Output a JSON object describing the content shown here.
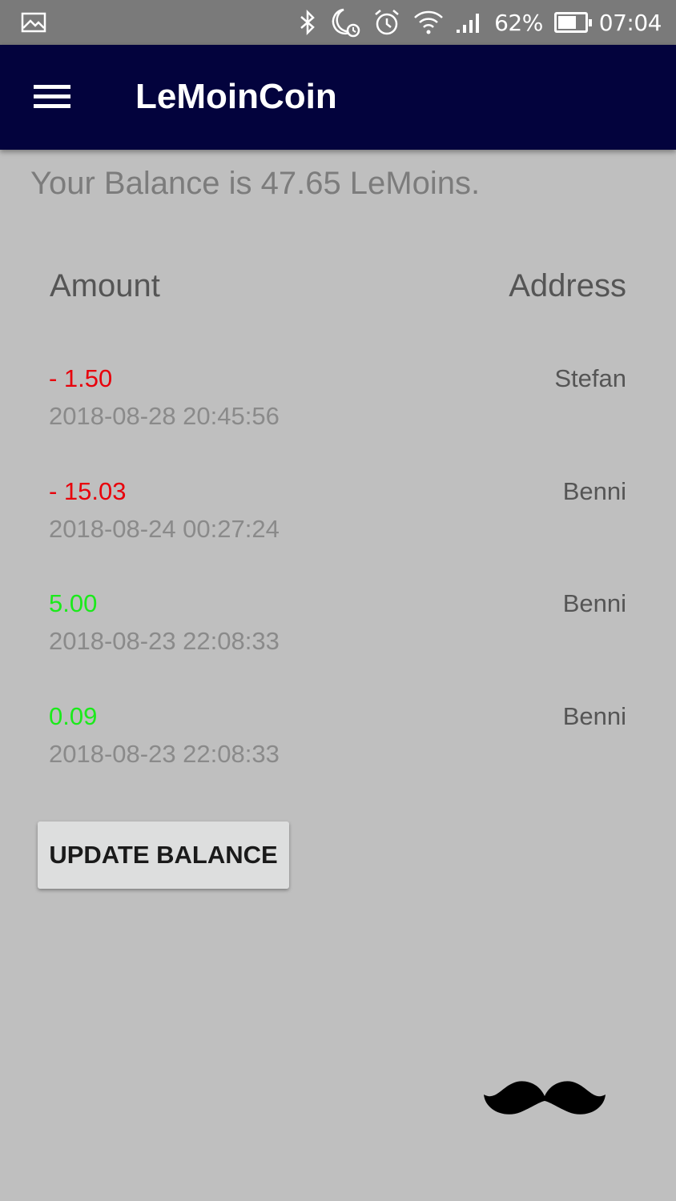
{
  "status_bar": {
    "battery_percent_text": "62%",
    "battery_level": 0.62,
    "time": "07:04",
    "icons": [
      "gallery-icon",
      "bluetooth-icon",
      "do-not-disturb-icon",
      "alarm-icon",
      "wifi-icon",
      "signal-icon",
      "battery-icon"
    ]
  },
  "app_bar": {
    "title": "LeMoinCoin",
    "menu_icon": "hamburger-menu-icon",
    "background_color": "#03033d"
  },
  "balance_text": "Your Balance is 47.65 LeMoins.",
  "table": {
    "headers": {
      "amount": "Amount",
      "address": "Address"
    },
    "transactions": [
      {
        "amount": "- 1.50",
        "date": "2018-08-28 20:45:56",
        "address": "Stefan",
        "color": "#e8000b"
      },
      {
        "amount": "- 15.03",
        "date": "2018-08-24 00:27:24",
        "address": "Benni",
        "color": "#e8000b"
      },
      {
        "amount": "5.00",
        "date": "2018-08-23 22:08:33",
        "address": "Benni",
        "color": "#1bea1b"
      },
      {
        "amount": "0.09",
        "date": "2018-08-23 22:08:33",
        "address": "Benni",
        "color": "#1bea1b"
      }
    ]
  },
  "update_button": {
    "label": "UPDATE BALANCE"
  },
  "decoration": {
    "icon": "mustache-icon"
  }
}
